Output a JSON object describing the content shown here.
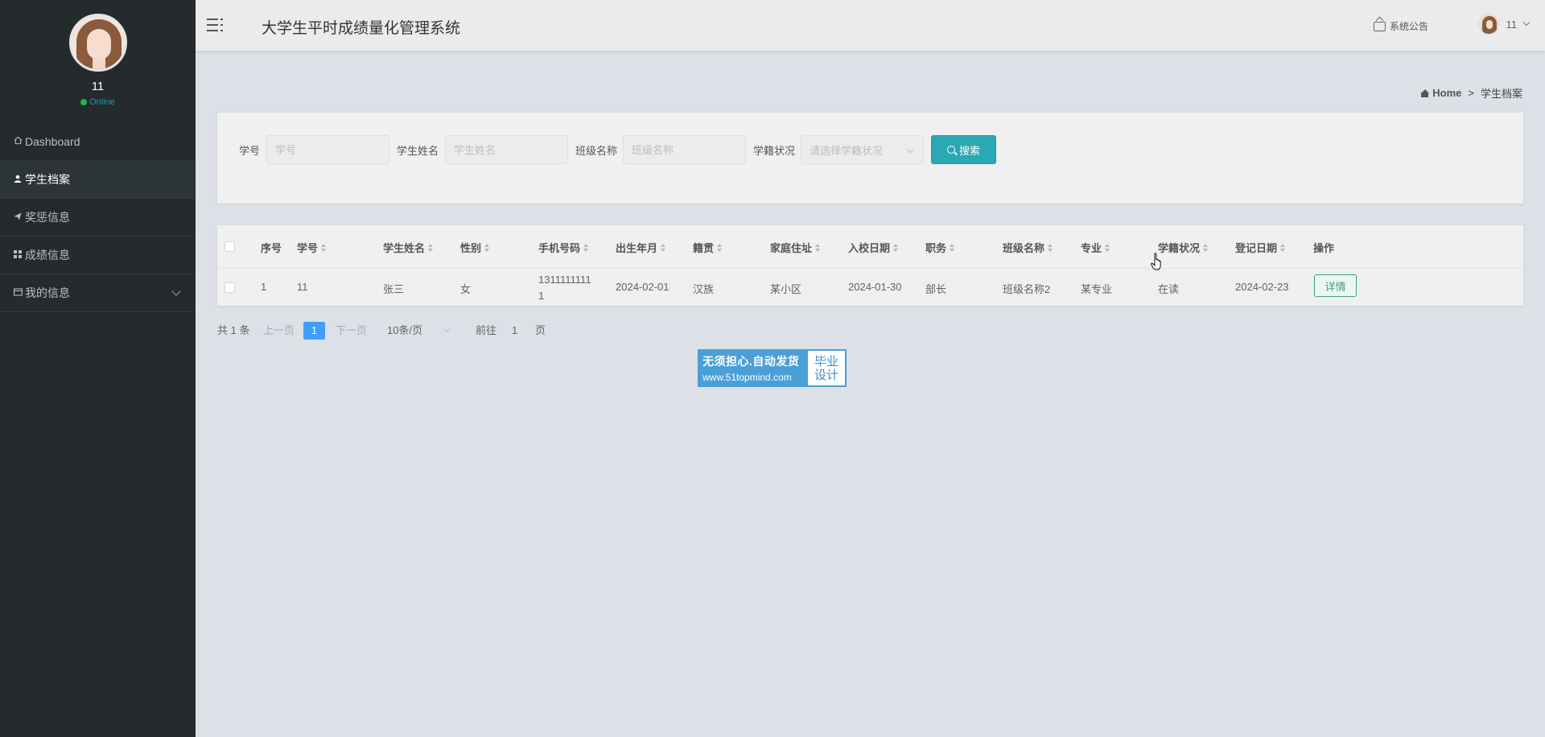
{
  "sidebar": {
    "user_name": "11",
    "status": "Online",
    "items": [
      {
        "label": "Dashboard",
        "icon": "home-icon"
      },
      {
        "label": "学生档案",
        "icon": "user-icon"
      },
      {
        "label": "奖惩信息",
        "icon": "send-icon"
      },
      {
        "label": "成绩信息",
        "icon": "grid-icon"
      },
      {
        "label": "我的信息",
        "icon": "id-card-icon"
      }
    ]
  },
  "header": {
    "title": "大学生平时成绩量化管理系统",
    "notice": "系统公告",
    "user": "11"
  },
  "breadcrumb": {
    "home": "Home",
    "separator": ">",
    "current": "学生档案"
  },
  "search": {
    "fields": [
      {
        "label": "学号",
        "placeholder": "学号"
      },
      {
        "label": "学生姓名",
        "placeholder": "学生姓名"
      },
      {
        "label": "班级名称",
        "placeholder": "班级名称"
      }
    ],
    "status_label": "学籍状况",
    "status_placeholder": "请选择学籍状况",
    "button": "搜索"
  },
  "table": {
    "columns": [
      "序号",
      "学号",
      "学生姓名",
      "性别",
      "手机号码",
      "出生年月",
      "籍贯",
      "家庭住址",
      "入校日期",
      "职务",
      "班级名称",
      "专业",
      "学籍状况",
      "登记日期",
      "操作"
    ],
    "rows": [
      {
        "index": "1",
        "student_no": "11",
        "name": "张三",
        "gender": "女",
        "phone_line1": "1311111111",
        "phone_line2": "1",
        "birth": "2024-02-01",
        "native_place": "汉族",
        "address": "某小区",
        "enroll_date": "2024-01-30",
        "position": "部长",
        "class_name": "班级名称2",
        "major": "某专业",
        "status": "在读",
        "register_date": "2024-02-23",
        "action": "详情"
      }
    ]
  },
  "pagination": {
    "total": "共 1 条",
    "prev": "上一页",
    "current": "1",
    "next": "下一页",
    "page_size": "10条/页",
    "goto_prefix": "前往",
    "goto_value": "1",
    "goto_suffix": "页"
  },
  "ad": {
    "line1": "无须担心.自动发货",
    "line2": "www.51topmind.com",
    "right": "毕业设计"
  },
  "colors": {
    "sidebar_bg": "#252b2c",
    "primary_teal": "#2aa8b3",
    "page_blue": "#409eff",
    "detail_green": "#3aa47a",
    "online_green": "#1fb44a"
  }
}
